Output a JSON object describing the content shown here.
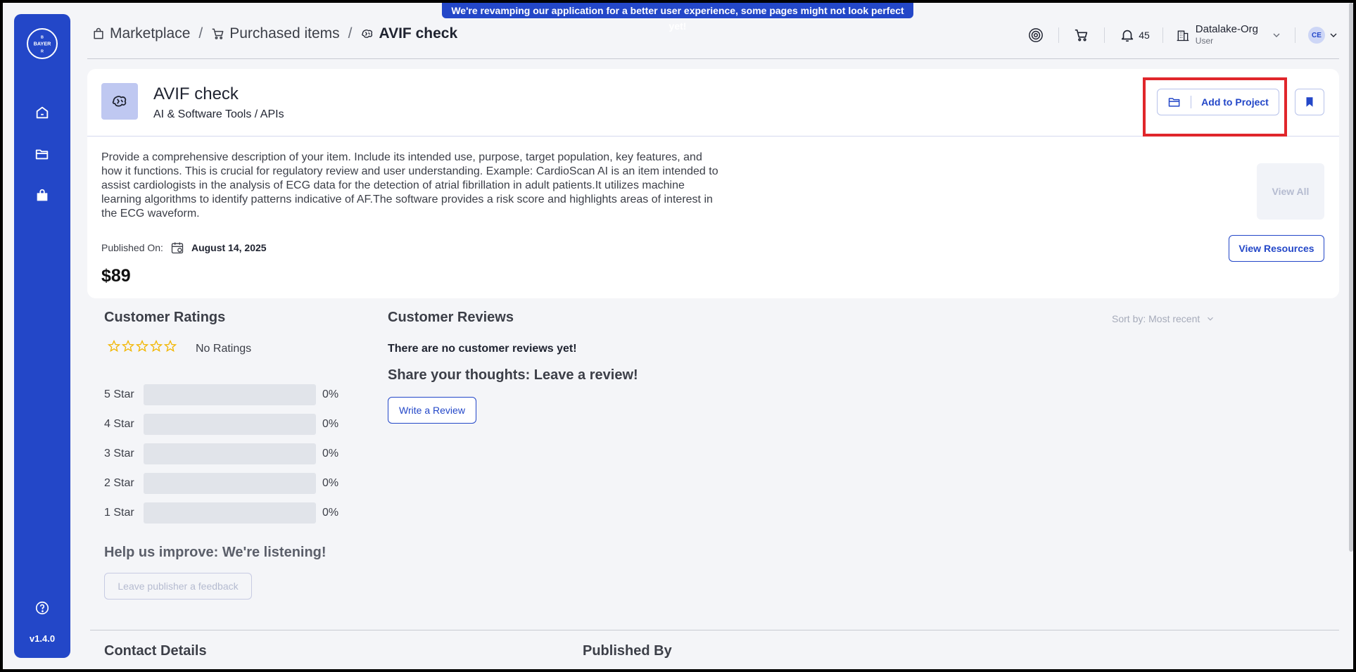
{
  "banner": {
    "text": "We're revamping our application for a better user experience, some pages might not look perfect yet!"
  },
  "sidebar": {
    "logo_text": "BAYER",
    "items": [
      {
        "name": "home",
        "icon": "home-icon"
      },
      {
        "name": "projects",
        "icon": "folder-icon"
      },
      {
        "name": "marketplace",
        "icon": "bag-icon"
      }
    ],
    "help_icon": "help-icon",
    "version": "v1.4.0"
  },
  "header": {
    "breadcrumbs": [
      {
        "label": "Marketplace",
        "icon": "bag-icon"
      },
      {
        "label": "Purchased items",
        "icon": "cart-icon"
      },
      {
        "label": "AVIF check",
        "icon": "brain-icon"
      }
    ],
    "separator": "/",
    "notification_count": "45",
    "org_name": "Datalake-Org",
    "org_role": "User",
    "avatar_initials": "CE"
  },
  "product": {
    "title": "AVIF check",
    "category": "AI & Software Tools / APIs",
    "add_to_project": "Add to Project",
    "description": "Provide a comprehensive description of your item. Include its intended use, purpose, target population, key features, and how it functions. This is crucial for regulatory review and user understanding. Example: CardioScan AI is an item intended to assist cardiologists in the analysis of ECG data for the detection of atrial fibrillation in adult patients.It utilizes machine learning algorithms to identify patterns indicative of AF.The software provides a risk score and highlights areas of interest in the ECG waveform.",
    "view_all": "View All",
    "published_label": "Published On:",
    "published_date": "August 14, 2025",
    "view_resources": "View Resources",
    "price": "$89"
  },
  "ratings": {
    "title": "Customer Ratings",
    "no_ratings": "No Ratings",
    "rows": [
      {
        "label": "5 Star",
        "pct": "0%"
      },
      {
        "label": "4 Star",
        "pct": "0%"
      },
      {
        "label": "3 Star",
        "pct": "0%"
      },
      {
        "label": "2 Star",
        "pct": "0%"
      },
      {
        "label": "1 Star",
        "pct": "0%"
      }
    ],
    "help_title": "Help us improve: We're listening!",
    "feedback_button": "Leave publisher a feedback"
  },
  "reviews": {
    "title": "Customer Reviews",
    "sort_label": "Sort by: Most recent",
    "empty_text": "There are no customer reviews yet!",
    "share_text": "Share your thoughts: Leave a review!",
    "write_button": "Write a Review"
  },
  "footer_sections": {
    "contact": "Contact Details",
    "published_by": "Published By"
  },
  "colors": {
    "brand": "#2347c8",
    "highlight": "#e0262b",
    "star": "#f2b705"
  }
}
